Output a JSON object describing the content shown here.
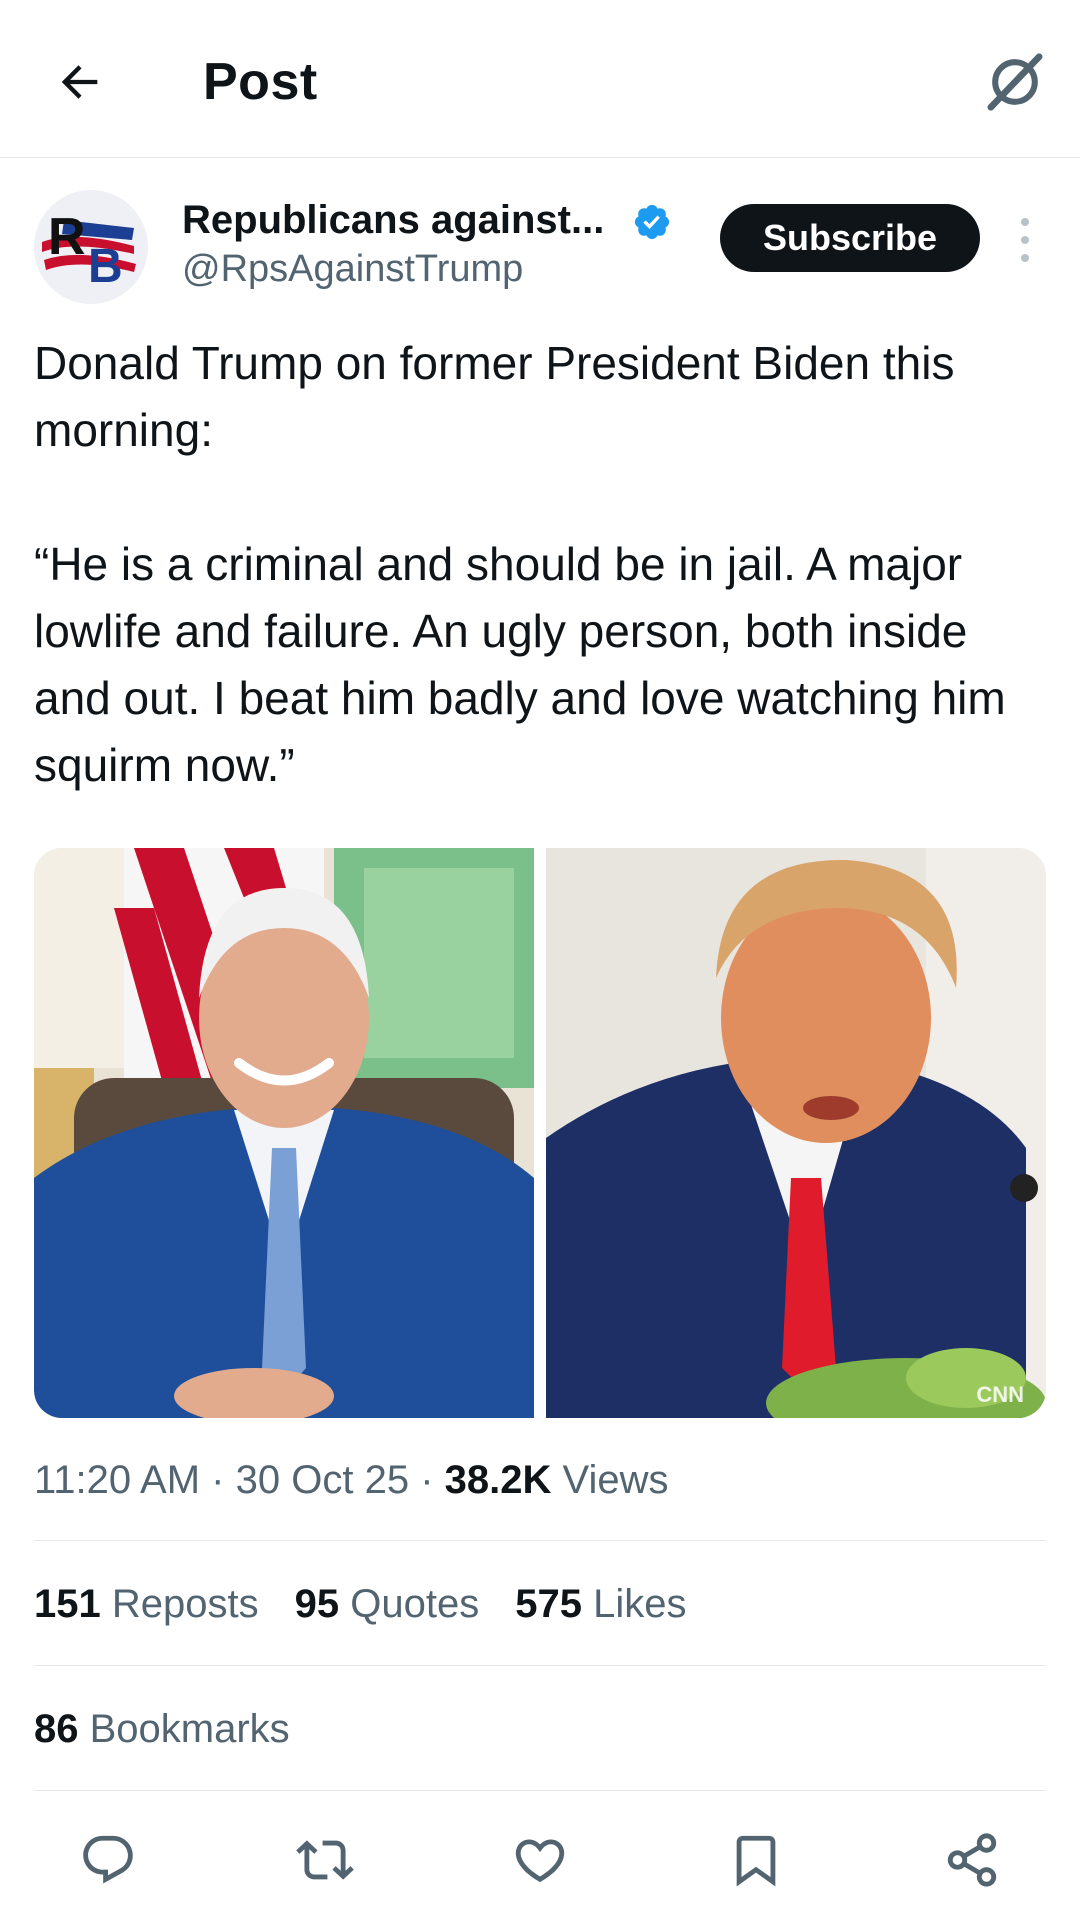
{
  "header": {
    "title": "Post",
    "back_icon": "arrow-left-icon",
    "grok_icon": "grok-icon"
  },
  "author": {
    "name": "Republicans against...",
    "handle": "@RpsAgainstTrump",
    "avatar_text": "RB",
    "verified_color": "#1d9bf0",
    "subscribe_label": "Subscribe"
  },
  "post": {
    "text": "Donald Trump on former President Biden this morning:\n\n“He is a criminal and should be in jail. A major lowlife and failure. An ugly person, both inside and out. I beat him badly and love watching him squirm now.”",
    "images": [
      {
        "name": "photo-biden"
      },
      {
        "name": "photo-trump",
        "watermark": "CNN"
      }
    ]
  },
  "meta": {
    "time": "11:20 AM",
    "date": "30 Oct 25",
    "views_count": "38.2K",
    "views_label": "Views",
    "separator": "·"
  },
  "stats": {
    "reposts_count": "151",
    "reposts_label": "Reposts",
    "quotes_count": "95",
    "quotes_label": "Quotes",
    "likes_count": "575",
    "likes_label": "Likes",
    "bookmarks_count": "86",
    "bookmarks_label": "Bookmarks"
  },
  "actions": [
    "reply-icon",
    "repost-icon",
    "like-icon",
    "bookmark-icon",
    "share-icon"
  ],
  "colors": {
    "text": "#0f1419",
    "secondary": "#536471",
    "divider": "#e6e9ec",
    "accent": "#1d9bf0"
  }
}
